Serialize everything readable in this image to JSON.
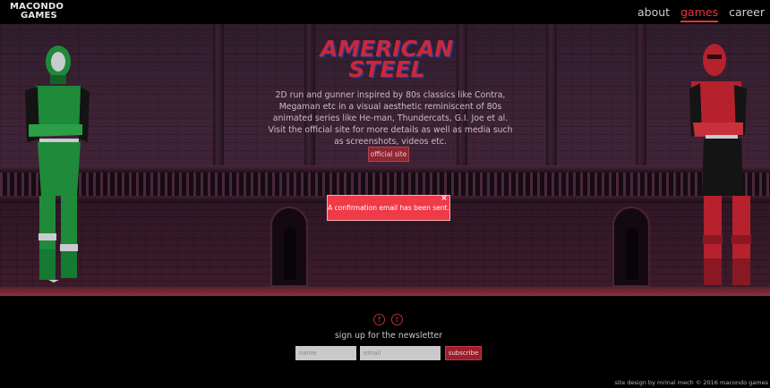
{
  "header": {
    "logo": {
      "line1": "MACONDO",
      "line2": "GAMES"
    },
    "nav": [
      {
        "label": "about",
        "active": false
      },
      {
        "label": "games",
        "active": true
      },
      {
        "label": "career",
        "active": false
      }
    ]
  },
  "hero": {
    "game_title": {
      "line1": "AMERICAN",
      "line2": "STEEL"
    },
    "description": "2D run and gunner inspired by 80s classics like Contra, Megaman etc in a visual aesthetic reminiscent of 80s animated series like He-man, Thundercats, G.I. Joe et al. Visit the official site for more details as well as media such as screenshots, videos etc.",
    "official_site_label": "official site"
  },
  "toast": {
    "message": "A confirmation email has been sent.",
    "close_label": "×"
  },
  "footer": {
    "social": [
      {
        "icon": "facebook-icon",
        "glyph": "f"
      },
      {
        "icon": "twitter-icon",
        "glyph": "t"
      }
    ],
    "newsletter_label": "sign up for the newsletter",
    "name_placeholder": "name",
    "email_placeholder": "email",
    "subscribe_label": "subscribe",
    "credits": "site design by mrinal mech   © 2016 macondo games"
  },
  "colors": {
    "accent": "#e8343f",
    "toast_bg": "#ef3a47",
    "hero_bg": "#3a2030",
    "green_hero": "#1f8a3a",
    "red_hero": "#b7212e"
  }
}
